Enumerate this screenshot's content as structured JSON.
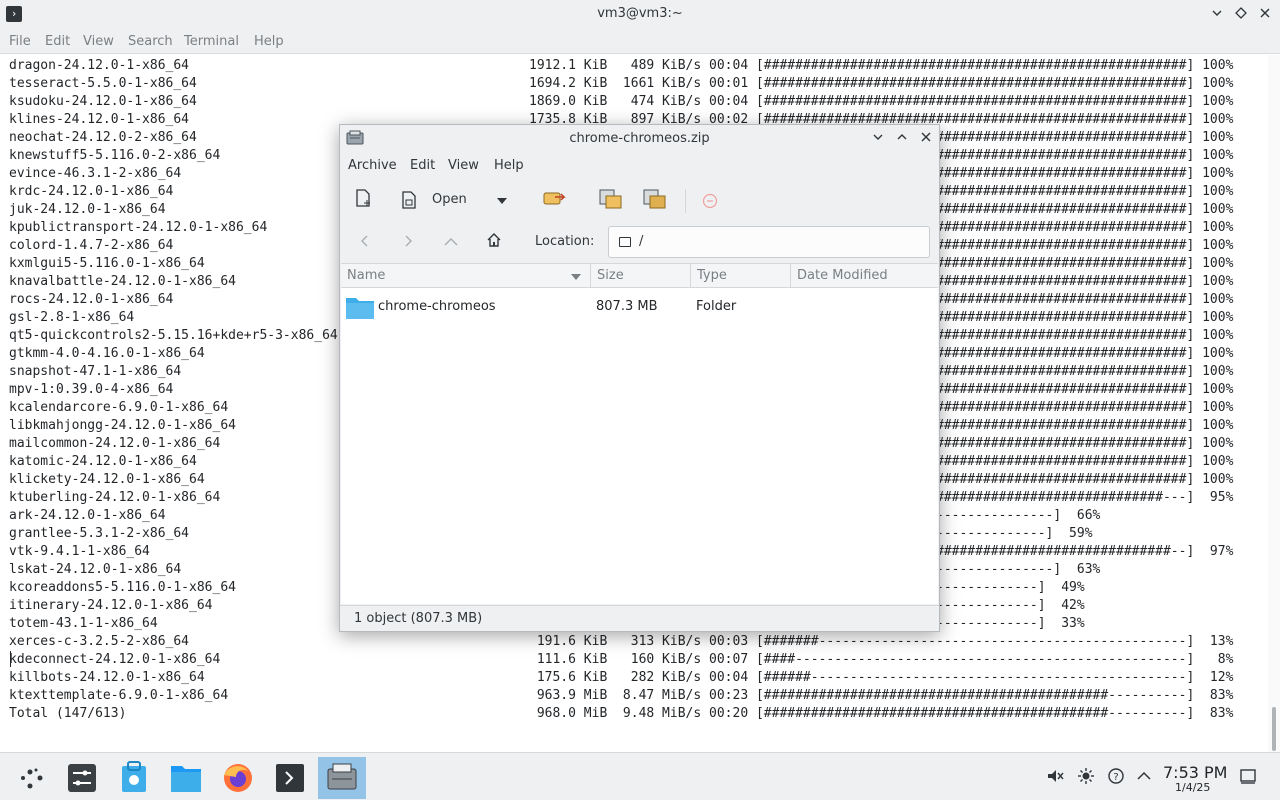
{
  "terminal": {
    "title": "vm3@vm3:~",
    "menu": [
      "File",
      "Edit",
      "View",
      "Search",
      "Terminal",
      "Help"
    ],
    "lines": [
      {
        "name": "dragon-24.12.0-1-x86_64",
        "stats": "1912.1 KiB   489 KiB/s 00:04 [######################################################] 100%"
      },
      {
        "name": "tesseract-5.5.0-1-x86_64",
        "stats": "1694.2 KiB  1661 KiB/s 00:01 [######################################################] 100%"
      },
      {
        "name": "ksudoku-24.12.0-1-x86_64",
        "stats": "1869.0 KiB   474 KiB/s 00:04 [######################################################] 100%"
      },
      {
        "name": "klines-24.12.0-1-x86_64",
        "stats": "1735.8 KiB   897 KiB/s 00:02 [######################################################] 100%"
      },
      {
        "name": "neochat-24.12.0-2-x86_64",
        "stats": "                              ######################################################] 100%"
      },
      {
        "name": "knewstuff5-5.116.0-2-x86_64",
        "stats": "                              ######################################################] 100%"
      },
      {
        "name": "evince-46.3.1-2-x86_64",
        "stats": "                              ######################################################] 100%"
      },
      {
        "name": "krdc-24.12.0-1-x86_64",
        "stats": "                              ######################################################] 100%"
      },
      {
        "name": "juk-24.12.0-1-x86_64",
        "stats": "                              ######################################################] 100%"
      },
      {
        "name": "kpublictransport-24.12.0-1-x86_64",
        "stats": "                              ######################################################] 100%"
      },
      {
        "name": "colord-1.4.7-2-x86_64",
        "stats": "                              ######################################################] 100%"
      },
      {
        "name": "kxmlgui5-5.116.0-1-x86_64",
        "stats": "                              ######################################################] 100%"
      },
      {
        "name": "knavalbattle-24.12.0-1-x86_64",
        "stats": "                              ######################################################] 100%"
      },
      {
        "name": "rocs-24.12.0-1-x86_64",
        "stats": "                              ######################################################] 100%"
      },
      {
        "name": "gsl-2.8-1-x86_64",
        "stats": "                              ######################################################] 100%"
      },
      {
        "name": "qt5-quickcontrols2-5.15.16+kde+r5-3-x86_64",
        "stats": "                              ######################################################] 100%"
      },
      {
        "name": "gtkmm-4.0-4.16.0-1-x86_64",
        "stats": "                              ######################################################] 100%"
      },
      {
        "name": "snapshot-47.1-1-x86_64",
        "stats": "                              ######################################################] 100%"
      },
      {
        "name": "mpv-1:0.39.0-4-x86_64",
        "stats": "                              ######################################################] 100%"
      },
      {
        "name": "kcalendarcore-6.9.0-1-x86_64",
        "stats": "                              ######################################################] 100%"
      },
      {
        "name": "libkmahjongg-24.12.0-1-x86_64",
        "stats": "                              ######################################################] 100%"
      },
      {
        "name": "mailcommon-24.12.0-1-x86_64",
        "stats": "                              ######################################################] 100%"
      },
      {
        "name": "katomic-24.12.0-1-x86_64",
        "stats": "                              ######################################################] 100%"
      },
      {
        "name": "klickety-24.12.0-1-x86_64",
        "stats": "                              ######################################################] 100%"
      },
      {
        "name": "ktuberling-24.12.0-1-x86_64",
        "stats": "                              ###################################################---]  95%"
      },
      {
        "name": "ark-24.12.0-1-x86_64",
        "stats": "                              #################--------------------]  66%"
      },
      {
        "name": "grantlee-5.3.1-2-x86_64",
        "stats": "                              ##############----------------------]  59%"
      },
      {
        "name": "vtk-9.4.1-1-x86_64",
        "stats": "                              ####################################################--]  97%"
      },
      {
        "name": "lskat-24.12.0-1-x86_64",
        "stats": "                              ################---------------------]  63%"
      },
      {
        "name": "kcoreaddons5-5.116.0-1-x86_64",
        "stats": "                              ######-----------------------------]  49%"
      },
      {
        "name": "itinerary-24.12.0-1-x86_64",
        "stats": "                              #----------------------------------]  42%"
      },
      {
        "name": "totem-43.1-1-x86_64",
        "stats": "                              -----------------------------------]  33%"
      },
      {
        "name": "xerces-c-3.2.5-2-x86_64",
        "stats": " 191.6 KiB   313 KiB/s 00:03 [#######-----------------------------------------------]  13%"
      },
      {
        "name": "kdeconnect-24.12.0-1-x86_64",
        "stats": " 111.6 KiB   160 KiB/s 00:07 [####--------------------------------------------------]   8%"
      },
      {
        "name": "killbots-24.12.0-1-x86_64",
        "stats": " 175.6 KiB   282 KiB/s 00:04 [######------------------------------------------------]  12%"
      },
      {
        "name": "ktexttemplate-6.9.0-1-x86_64",
        "stats": " 963.9 MiB  8.47 MiB/s 00:23 [############################################----------]  83%"
      },
      {
        "name": "Total (147/613)",
        "stats": " 968.0 MiB  9.48 MiB/s 00:20 [############################################----------]  83%"
      }
    ]
  },
  "ark": {
    "title": "chrome-chromeos.zip",
    "menu": [
      "Archive",
      "Edit",
      "View",
      "Help"
    ],
    "toolbar": {
      "open_label": "Open"
    },
    "location_label": "Location:",
    "location_path": "/",
    "columns": [
      "Name",
      "Size",
      "Type",
      "Date Modified"
    ],
    "rows": [
      {
        "name": "chrome-chromeos",
        "size": "807.3 MB",
        "type": "Folder",
        "date": ""
      }
    ],
    "status": "1 object (807.3 MB)"
  },
  "taskbar": {
    "time": "7:53 PM",
    "date": "1/4/25"
  }
}
